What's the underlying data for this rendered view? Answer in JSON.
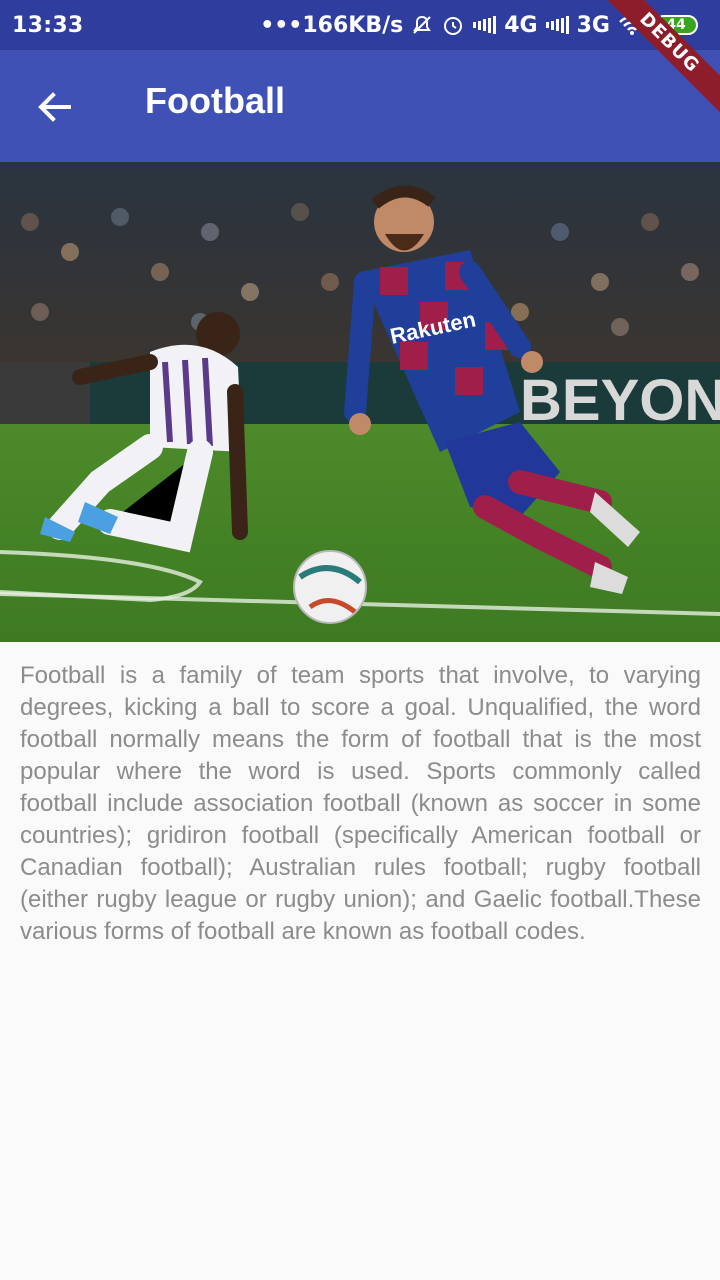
{
  "status_bar": {
    "time": "13:33",
    "network_speed": "•••166KB/s",
    "network_1": "4G",
    "network_2": "3G",
    "battery": "44"
  },
  "debug_banner": "DEBUG",
  "app_bar": {
    "title": "Football",
    "back_icon": "arrow-left-icon"
  },
  "content": {
    "description": "Football is a family of team sports that involve, to varying degrees, kicking a ball to score a goal. Unqualified, the word football normally means the form of football that is the most popular where the word is used. Sports commonly called football include association football (known as soccer in some countries); gridiron football (specifically American football or Canadian football); Australian rules football; rugby football (either rugby league or rugby union); and Gaelic football.These various forms of football are known as football codes."
  },
  "hero_image": {
    "jersey_text": "Rakuten",
    "board_text": "BEYON"
  },
  "colors": {
    "status_bar": "#2f3e9e",
    "app_bar": "#3f51b5",
    "background": "#fafafa",
    "text": "#8c8c8c"
  }
}
